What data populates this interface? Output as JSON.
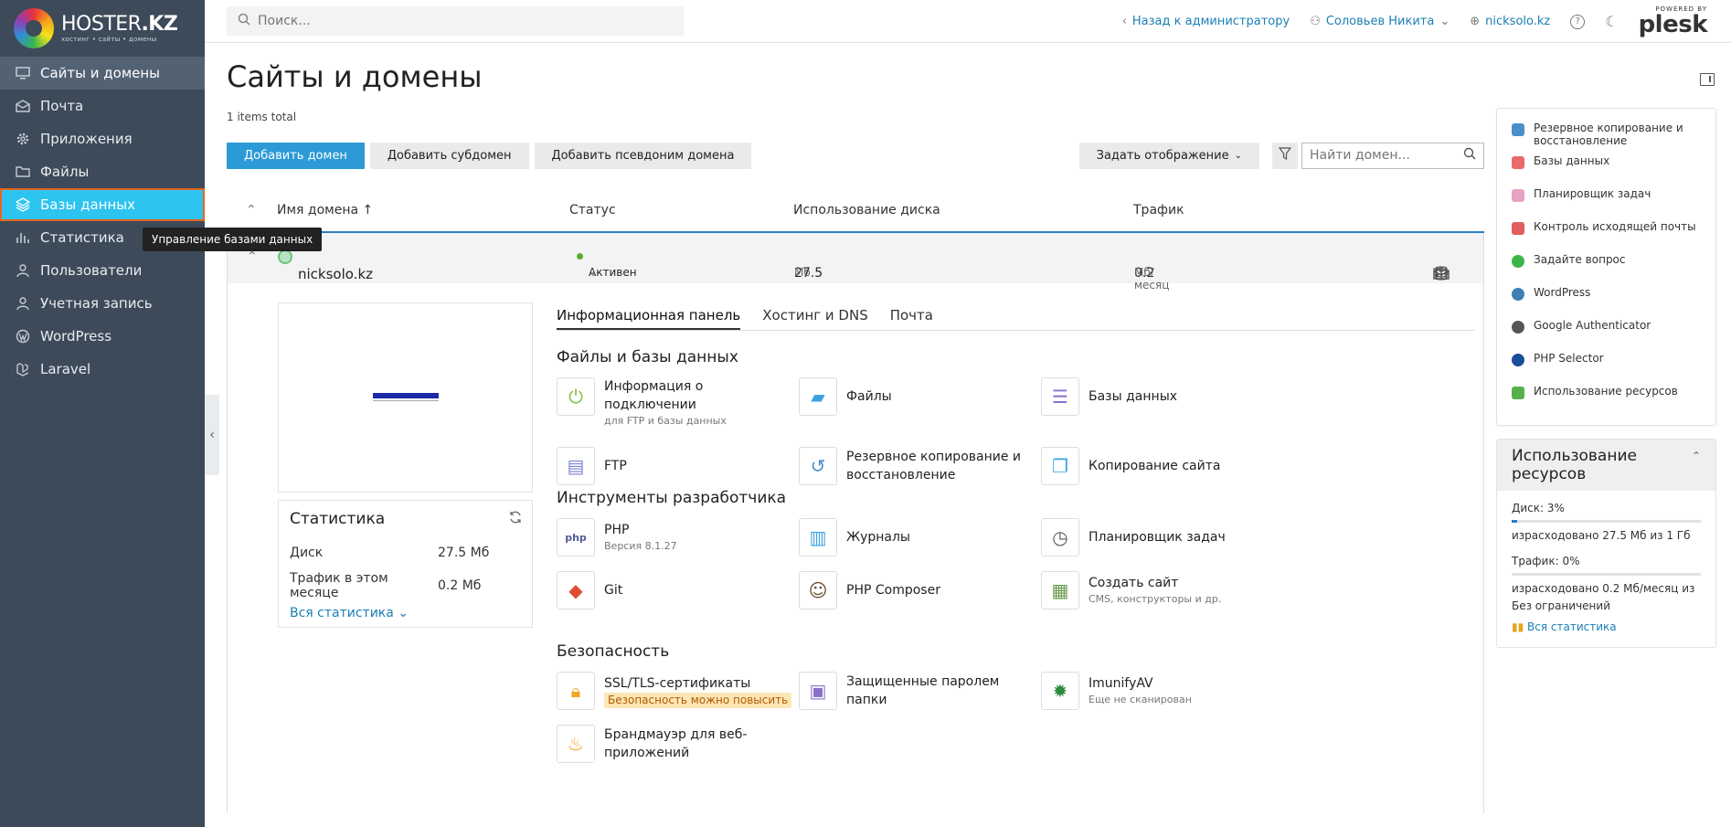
{
  "brand": {
    "name_a": "HOSTER",
    "name_b": ".KZ",
    "tagline": "хостинг • сайты • домены"
  },
  "sidebar": {
    "items": [
      {
        "label": "Сайты и домены",
        "icon": "monitor-icon"
      },
      {
        "label": "Почта",
        "icon": "mail-icon"
      },
      {
        "label": "Приложения",
        "icon": "gear-icon"
      },
      {
        "label": "Файлы",
        "icon": "folder-icon"
      },
      {
        "label": "Базы данных",
        "icon": "layers-icon"
      },
      {
        "label": "Статистика",
        "icon": "bar-chart-icon"
      },
      {
        "label": "Пользователи",
        "icon": "user-icon"
      },
      {
        "label": "Учетная запись",
        "icon": "account-icon"
      },
      {
        "label": "WordPress",
        "icon": "wordpress-icon"
      },
      {
        "label": "Laravel",
        "icon": "laravel-icon"
      }
    ],
    "tooltip": "Управление базами данных"
  },
  "topbar": {
    "search_placeholder": "Поиск...",
    "back_to_admin": "Назад к администратору",
    "user": "Соловьев Никита",
    "domain": "nicksolo.kz",
    "powered": "POWERED BY",
    "plesk": "plesk"
  },
  "page": {
    "title": "Сайты и домены",
    "items_total": "1 items total",
    "buttons": {
      "add_domain": "Добавить домен",
      "add_subdomain": "Добавить субдомен",
      "add_alias": "Добавить псевдоним домена",
      "view": "Задать отображение"
    },
    "find_placeholder": "Найти домен..."
  },
  "table": {
    "headers": {
      "name": "Имя домена ↑",
      "status": "Статус",
      "disk": "Использование диска",
      "traffic": "Трафик"
    },
    "row": {
      "domain": "nicksolo.kz",
      "status": "Активен",
      "disk_value": "27.5",
      "disk_unit": "Мб",
      "traffic_value": "0.2",
      "traffic_unit": "Мб/месяц"
    }
  },
  "stats": {
    "title": "Статистика",
    "disk_label": "Диск",
    "disk_value": "27.5 Мб",
    "traffic_label": "Трафик в этом месяце",
    "traffic_value": "0.2 Мб",
    "all_link": "Вся статистика"
  },
  "tabs": [
    "Информационная панель",
    "Хостинг и DNS",
    "Почта"
  ],
  "sections": {
    "files": {
      "title": "Файлы и базы данных",
      "tools": [
        {
          "title": "Информация о подключении",
          "sub": "для FTP и базы данных"
        },
        {
          "title": "Файлы",
          "sub": ""
        },
        {
          "title": "Базы данных",
          "sub": ""
        },
        {
          "title": "FTP",
          "sub": ""
        },
        {
          "title": "Резервное копирование и восстановление",
          "sub": ""
        },
        {
          "title": "Копирование сайта",
          "sub": ""
        }
      ]
    },
    "dev": {
      "title": "Инструменты разработчика",
      "tools": [
        {
          "title": "PHP",
          "sub": "Версия 8.1.27"
        },
        {
          "title": "Журналы",
          "sub": ""
        },
        {
          "title": "Планировщик задач",
          "sub": ""
        },
        {
          "title": "Git",
          "sub": ""
        },
        {
          "title": "PHP Composer",
          "sub": ""
        },
        {
          "title": "Создать сайт",
          "sub": "CMS, конструкторы и др."
        }
      ]
    },
    "security": {
      "title": "Безопасность",
      "tools": [
        {
          "title": "SSL/TLS-сертификаты",
          "sub": "Безопасность можно повысить"
        },
        {
          "title": "Защищенные паролем папки",
          "sub": ""
        },
        {
          "title": "ImunifyAV",
          "sub": "Еще не сканирован"
        },
        {
          "title": "Брандмауэр для веб-приложений",
          "sub": ""
        }
      ]
    }
  },
  "quick_links": [
    {
      "label": "Резервное копирование и восстановление",
      "color": "#4a8fc9"
    },
    {
      "label": "Базы данных",
      "color": "#e86a6a"
    },
    {
      "label": "Планировщик задач",
      "color": "#e7a1c4"
    },
    {
      "label": "Контроль исходящей почты",
      "color": "#e25d5d"
    },
    {
      "label": "Задайте вопрос",
      "color": "#3bb54a"
    },
    {
      "label": "WordPress",
      "color": "#3d7fb5"
    },
    {
      "label": "Google Authenticator",
      "color": "#555555"
    },
    {
      "label": "PHP Selector",
      "color": "#1a4e9a"
    },
    {
      "label": "Использование ресурсов",
      "color": "#56b04d"
    }
  ],
  "usage": {
    "title": "Использование ресурсов",
    "disk": "Диск: 3%",
    "disk_fraction": 0.03,
    "disk_detail": "израсходовано 27.5 Мб из 1 Гб",
    "traffic": "Трафик: 0%",
    "traffic_fraction": 0,
    "traffic_detail": "израсходовано 0.2 Мб/месяц из Без ограничений",
    "all_link": "Вся статистика"
  }
}
